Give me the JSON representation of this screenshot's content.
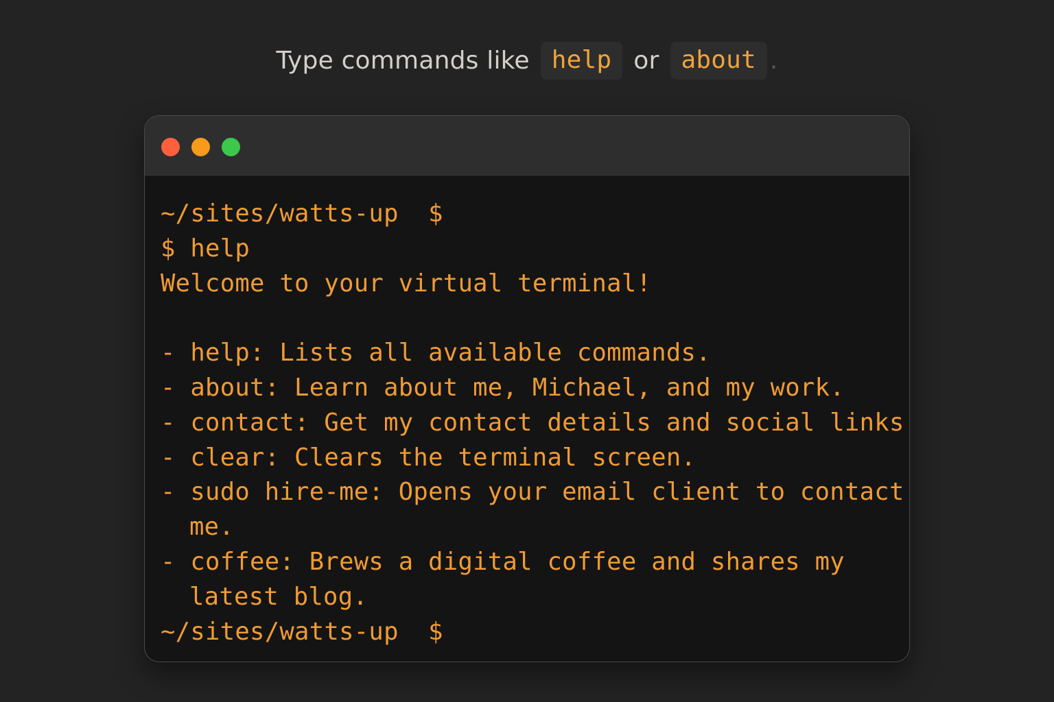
{
  "hint": {
    "prefix": "Type commands like",
    "cmd1": "help",
    "connector": "or",
    "cmd2": "about",
    "suffix": "."
  },
  "window": {
    "controls": [
      "close",
      "minimize",
      "maximize"
    ],
    "colors": {
      "close": "#ff5f3c",
      "minimize": "#f89a1c",
      "maximize": "#3cc84a"
    }
  },
  "terminal": {
    "accent_color": "#f09b34",
    "prompt1": "~/sites/watts-up  $",
    "command": "$ help",
    "welcome": "Welcome to your virtual terminal!",
    "commands": [
      {
        "line1": "- help: Lists all available commands."
      },
      {
        "line1": "- about: Learn about me, Michael, and my work."
      },
      {
        "line1": "- contact: Get my contact details and social links."
      },
      {
        "line1": "- clear: Clears the terminal screen."
      },
      {
        "line1": "- sudo hire-me: Opens your email client to contact",
        "line2": "me."
      },
      {
        "line1": "- coffee: Brews a digital coffee and shares my",
        "line2": "latest blog."
      }
    ],
    "prompt2": "~/sites/watts-up  $"
  }
}
